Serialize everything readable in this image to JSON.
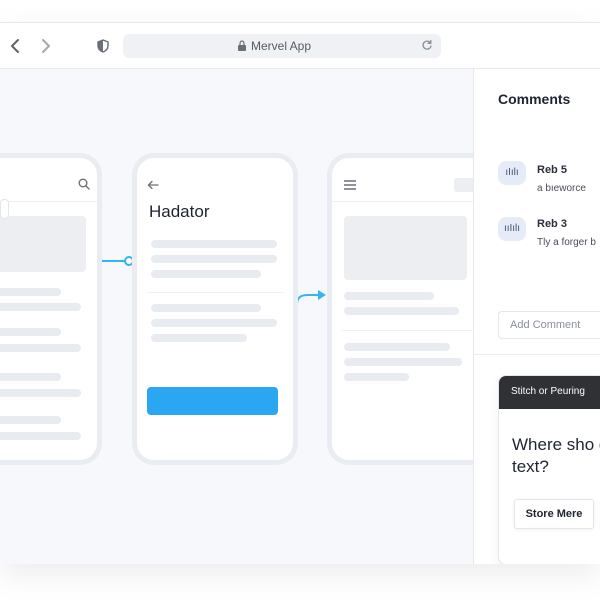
{
  "window": {
    "url_text": "Mervel App"
  },
  "icons": {
    "back": "chevron-left",
    "forward": "chevron-right",
    "privacy": "shield-half",
    "lock": "lock",
    "reload": "reload",
    "search": "search",
    "arrow_left": "arrow-left",
    "menu": "hamburger-menu"
  },
  "colors": {
    "accent": "#2aa6f3",
    "connector": "#36b3f0",
    "popup_header": "#2f3135"
  },
  "canvas": {
    "screen2_heading": "Hadator"
  },
  "sidebar": {
    "title": "Comments",
    "comments": [
      {
        "avatar": "ıIılı",
        "name": "Reb 5",
        "text": "a bıeworce"
      },
      {
        "avatar": "ııIılı",
        "name": "Reb 3",
        "text": "Tly a forger b"
      }
    ],
    "add_comment_placeholder": "Add Comment",
    "popup": {
      "header": "Stitch or Peuring",
      "question": "Where sho go text?",
      "button": "Store Mere"
    }
  }
}
